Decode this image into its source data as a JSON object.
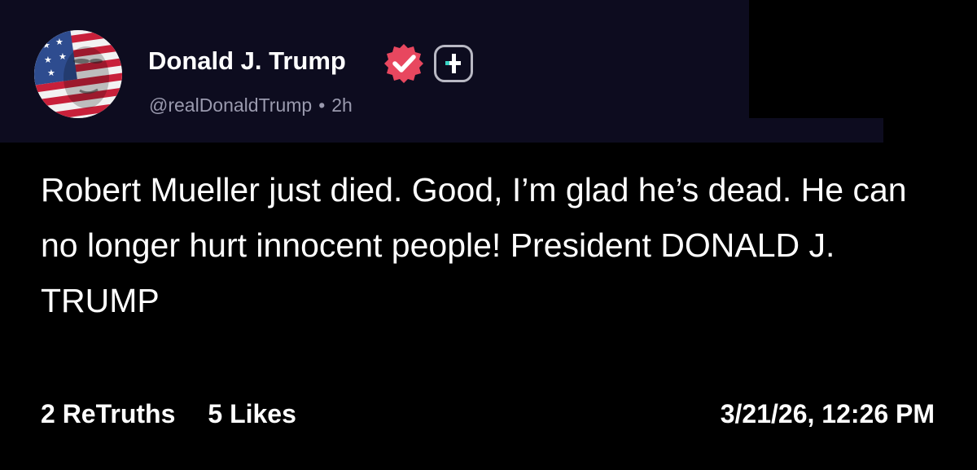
{
  "post": {
    "author": {
      "display_name": "Donald J. Trump",
      "handle": "@realDonaldTrump",
      "age": "2h",
      "separator": "•",
      "avatar_icon": "flag-face-avatar",
      "verified_icon": "verified-badge-icon",
      "extra_icon": "plus-badge-icon"
    },
    "text": "Robert Mueller just died. Good, I’m glad he’s dead. He can no longer hurt innocent people! President DONALD J. TRUMP",
    "stats": {
      "retruths": "2 ReTruths",
      "likes": "5 Likes"
    },
    "timestamp": "3/21/26, 12:26 PM"
  },
  "colors": {
    "background": "#000000",
    "header_background": "#0d0c1f",
    "verified_badge": "#e8475f",
    "handle_text": "#9a9aae",
    "primary_text": "#ffffff"
  }
}
